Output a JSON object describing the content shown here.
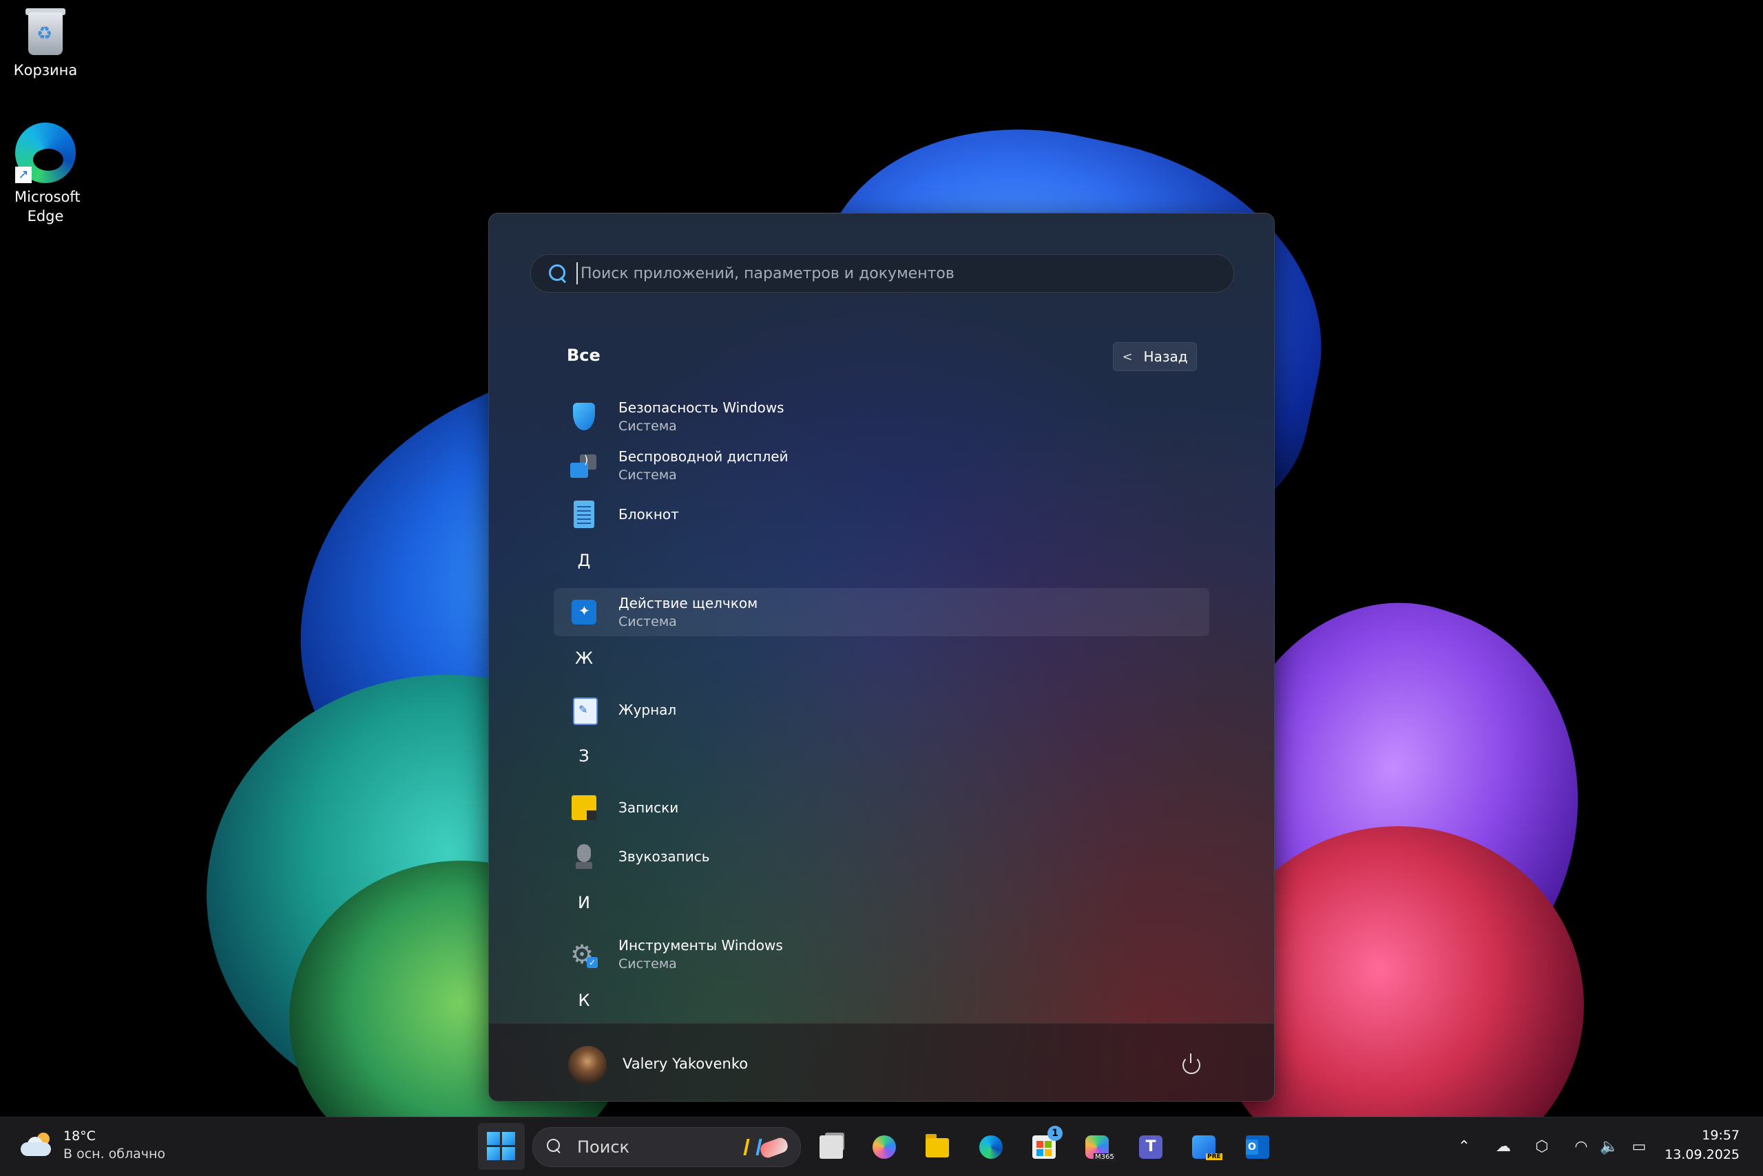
{
  "desktop": {
    "icons": [
      {
        "label": "Корзина"
      },
      {
        "label": "Microsoft Edge"
      }
    ]
  },
  "start_menu": {
    "search": {
      "placeholder": "Поиск приложений, параметров и документов"
    },
    "section_title": "Все",
    "back_label": "Назад",
    "items": [
      {
        "name": "Безопасность Windows",
        "sub": "Система",
        "icon": "windows-security-icon"
      },
      {
        "name": "Беспроводной дисплей",
        "sub": "Система",
        "icon": "wireless-display-icon"
      },
      {
        "name": "Блокнот",
        "icon": "notepad-icon"
      },
      {
        "letter": "Д"
      },
      {
        "name": "Действие щелчком",
        "sub": "Система",
        "icon": "click-to-do-icon"
      },
      {
        "letter": "Ж"
      },
      {
        "name": "Журнал",
        "icon": "journal-icon"
      },
      {
        "letter": "З"
      },
      {
        "name": "Записки",
        "icon": "sticky-notes-icon"
      },
      {
        "name": "Звукозапись",
        "icon": "sound-recorder-icon"
      },
      {
        "letter": "И"
      },
      {
        "name": "Инструменты Windows",
        "sub": "Система",
        "icon": "windows-tools-icon"
      },
      {
        "letter": "К"
      }
    ],
    "user": {
      "name": "Valery Yakovenko"
    }
  },
  "taskbar": {
    "weather": {
      "temp": "18°C",
      "desc": "В осн. облачно"
    },
    "search_label": "Поиск",
    "apps": [
      {
        "name": "task-view"
      },
      {
        "name": "copilot"
      },
      {
        "name": "file-explorer"
      },
      {
        "name": "microsoft-edge"
      },
      {
        "name": "microsoft-store",
        "badge": "1"
      },
      {
        "name": "microsoft-365-copilot"
      },
      {
        "name": "microsoft-teams"
      },
      {
        "name": "preview-app"
      },
      {
        "name": "outlook"
      }
    ],
    "tray": {
      "icons": [
        "chevron-up-icon",
        "onedrive-icon",
        "network-app-icon",
        "wifi-icon",
        "volume-icon",
        "battery-icon"
      ]
    },
    "clock": {
      "time": "19:57",
      "date": "13.09.2025"
    }
  }
}
